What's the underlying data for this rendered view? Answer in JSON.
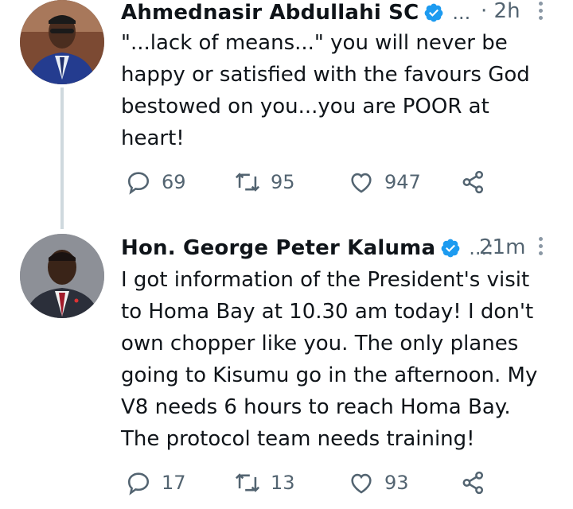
{
  "tweets": [
    {
      "author_name": "Ahmednasir Abdullahi SC",
      "handle": "...",
      "time": "· 2h",
      "text": "\"...lack of means...\" you will never be\nhappy or satisfied with the favours God\nbestowed on you...you are POOR at\nheart!",
      "replies": "69",
      "retweets": "95",
      "likes": "947",
      "verified": true,
      "icons": [
        "reply-icon",
        "retweet-icon",
        "like-icon",
        "share-icon",
        "more-icon",
        "verified-badge-icon"
      ]
    },
    {
      "author_name": "Hon. George Peter Kaluma",
      "handle": "...:",
      "time": "21m",
      "text": "I got information of the President's visit\nto Homa Bay at 10.30 am today! I don't\nown chopper like you. The only planes\ngoing to Kisumu go in the afternoon. My\nV8 needs 6 hours to reach Homa Bay.\nThe protocol team needs training!",
      "replies": "17",
      "retweets": "13",
      "likes": "93",
      "verified": true,
      "icons": [
        "reply-icon",
        "retweet-icon",
        "like-icon",
        "share-icon",
        "more-icon",
        "verified-badge-icon"
      ]
    }
  ],
  "colors": {
    "verified": "#1d9bf0",
    "muted": "#536471",
    "thread_line": "#cfd9de",
    "text": "#0f1419"
  }
}
